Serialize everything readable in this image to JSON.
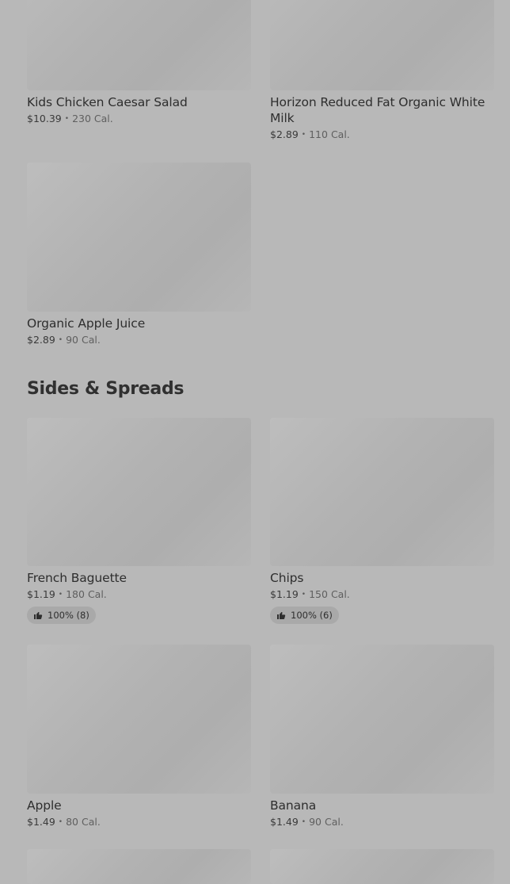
{
  "items_top": [
    {
      "name": "Kids Chicken Caesar Salad",
      "price": "$10.39",
      "cal": "230 Cal."
    },
    {
      "name": "Horizon Reduced Fat Organic White Milk",
      "price": "$2.89",
      "cal": "110 Cal."
    },
    {
      "name": "Organic Apple Juice",
      "price": "$2.89",
      "cal": "90 Cal."
    }
  ],
  "section": {
    "title": "Sides & Spreads"
  },
  "items_sides": [
    {
      "name": "French Baguette",
      "price": "$1.19",
      "cal": "180 Cal.",
      "rating": "100% (8)"
    },
    {
      "name": "Chips",
      "price": "$1.19",
      "cal": "150 Cal.",
      "rating": "100% (6)"
    },
    {
      "name": "Apple",
      "price": "$1.49",
      "cal": "80 Cal."
    },
    {
      "name": "Banana",
      "price": "$1.49",
      "cal": "90 Cal."
    }
  ],
  "meta_separator": "•",
  "icons": {
    "rating": "thumbs-up-icon"
  },
  "colors": {
    "background": "#b8b8b8",
    "thumbnail": "#b2b2b2",
    "rating_pill": "#a9a9a9"
  }
}
